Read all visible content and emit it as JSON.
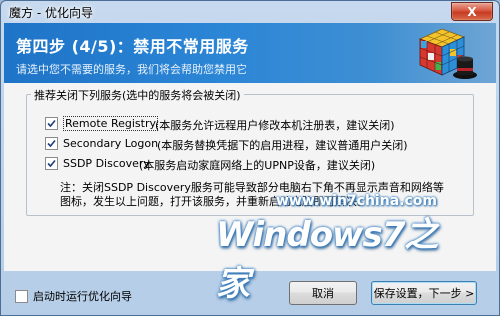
{
  "window": {
    "title": "魔方 - 优化向导",
    "close_label": "X"
  },
  "banner": {
    "title": "第四步 (4/5)：禁用不常用服务",
    "subtitle": "请选中您不需要的服务，我们将会帮助您禁用它",
    "icon": "rubiks-cube-magic-hat-icon"
  },
  "group": {
    "legend": "推荐关闭下列服务(选中的服务将会被关闭)",
    "options": [
      {
        "label": "Remote Registry",
        "checked": true,
        "description": "(本服务允许远程用户修改本机注册表，建议关闭)"
      },
      {
        "label": "Secondary Logon",
        "checked": true,
        "description": "(本服务替换凭据下的启用进程，建议普通用户关闭)"
      },
      {
        "label": "SSDP Discovery",
        "checked": true,
        "description": "(本服务启动家庭网络上的UPNP设备，建议关闭)"
      }
    ],
    "note": "注：关闭SSDP Discovery服务可能导致部分电脑右下角不再显示声音和网络等图标，发生以上问题，打开该服务，并重新启动电脑即可解决。"
  },
  "watermark": {
    "url": "www.win7china.com",
    "brand": "Windows7之家"
  },
  "footer": {
    "startup_checkbox_label": "启动时运行优化向导",
    "startup_checked": false,
    "cancel_label": "取消",
    "next_label": "保存设置，下一步 >"
  },
  "colors": {
    "banner_blue": "#1e74c7",
    "close_red": "#c63b22",
    "window_frame": "#b5cde7"
  }
}
